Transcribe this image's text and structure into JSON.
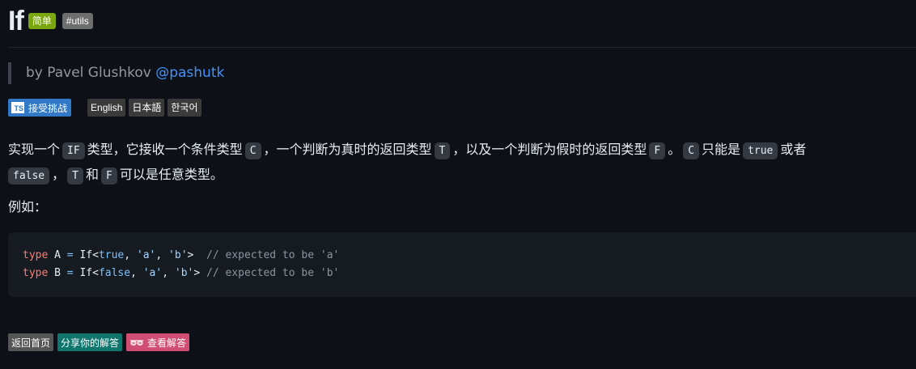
{
  "header": {
    "title": "If",
    "difficulty_badge": "简单",
    "tag_badge": "#utils"
  },
  "byline": {
    "prefix": "by Pavel Glushkov",
    "author_handle": "@pashutk"
  },
  "badges": {
    "accept_label": "接受挑战",
    "ts_logo": "TS",
    "languages": [
      "English",
      "日本語",
      "한국어"
    ]
  },
  "description": {
    "s1": "实现一个",
    "c1": "IF",
    "s2": "类型，它接收一个条件类型",
    "c2": "C",
    "s3": "，一个判断为真时的返回类型",
    "c3": "T",
    "s4": "，以及一个判断为假时的返回类型",
    "c4": "F",
    "s5": "。",
    "c5": "C",
    "s6": "只能是",
    "c6": "true",
    "s7": "或者",
    "c7": "false",
    "s8": "，",
    "c8": "T",
    "s9": "和",
    "c9": "F",
    "s10": "可以是任意类型。"
  },
  "example_label": "例如：",
  "code": {
    "line1": {
      "kw": "type",
      "name": " A ",
      "eq": "=",
      "call": " If<",
      "bool": "true",
      "sep1": ", ",
      "arg1": "'a'",
      "sep2": ", ",
      "arg2": "'b'",
      "close": ">",
      "gap": "  ",
      "comment": "// expected to be 'a'"
    },
    "line2": {
      "kw": "type",
      "name": " B ",
      "eq": "=",
      "call": " If<",
      "bool": "false",
      "sep1": ", ",
      "arg1": "'a'",
      "sep2": ", ",
      "arg2": "'b'",
      "close": ">",
      "gap": " ",
      "comment": "// expected to be 'b'"
    }
  },
  "footer": {
    "home_label": "返回首页",
    "share_label": "分享你的解答",
    "answers_label": "查看解答"
  },
  "colors": {
    "background": "#0d1117",
    "easy_badge": "#7aa70f",
    "link": "#4493f8",
    "ts_blue": "#3178c6",
    "share_teal": "#0f766e",
    "answers_pink": "#d04e73"
  }
}
